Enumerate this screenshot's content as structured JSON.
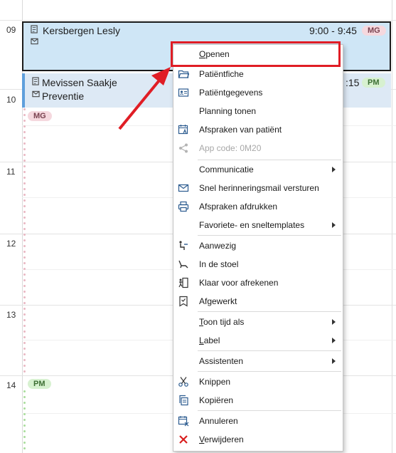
{
  "hours": [
    "09",
    "10",
    "11",
    "12",
    "13",
    "14"
  ],
  "appointments": [
    {
      "name": "Kersbergen Lesly",
      "time": "9:00 - 9:45",
      "badge": "MG"
    },
    {
      "name": "Mevissen Saakje",
      "subtitle": "Preventie",
      "time": ":15",
      "badge": "PM"
    }
  ],
  "free_badges": [
    "MG",
    "PM"
  ],
  "menu": {
    "items": [
      {
        "label_u": "O",
        "label_rest": "penen",
        "icon": "none"
      },
      {
        "label": "Patiëntfiche",
        "icon": "folder-icon"
      },
      {
        "label": "Patiëntgegevens",
        "icon": "id-card-icon"
      },
      {
        "label": "Planning tonen",
        "icon": "none"
      },
      {
        "label": "Afspraken van patiënt",
        "icon": "calendar-patient-icon"
      },
      {
        "label": "App code: 0M20",
        "icon": "share-icon",
        "disabled": true
      },
      {
        "label": "Communicatie",
        "submenu": true
      },
      {
        "label": "Snel herinneringsmail versturen",
        "icon": "mail-icon"
      },
      {
        "label": "Afspraken afdrukken",
        "icon": "printer-icon"
      },
      {
        "label": "Favoriete- en sneltemplates",
        "submenu": true
      },
      {
        "label": "Aanwezig",
        "icon": "arrival-icon"
      },
      {
        "label": "In de stoel",
        "icon": "dental-chair-icon"
      },
      {
        "label": "Klaar voor afrekenen",
        "icon": "exit-icon"
      },
      {
        "label": "Afgewerkt",
        "icon": "finished-icon"
      },
      {
        "label_u": "T",
        "label_rest": "oon tijd als",
        "submenu": true
      },
      {
        "label_u": "L",
        "label_rest": "abel",
        "submenu": true
      },
      {
        "label": "Assistenten",
        "submenu": true
      },
      {
        "label": "Knippen",
        "icon": "scissors-icon"
      },
      {
        "label": "Kopiëren",
        "icon": "copy-icon"
      },
      {
        "label": "Annuleren",
        "icon": "calendar-cancel-icon"
      },
      {
        "label_u": "V",
        "label_rest": "erwijderen",
        "icon": "delete-icon"
      }
    ]
  },
  "colors": {
    "highlight": "#e01d25",
    "appt_selected": "#cfe6f6",
    "appt": "#dde9f5"
  }
}
